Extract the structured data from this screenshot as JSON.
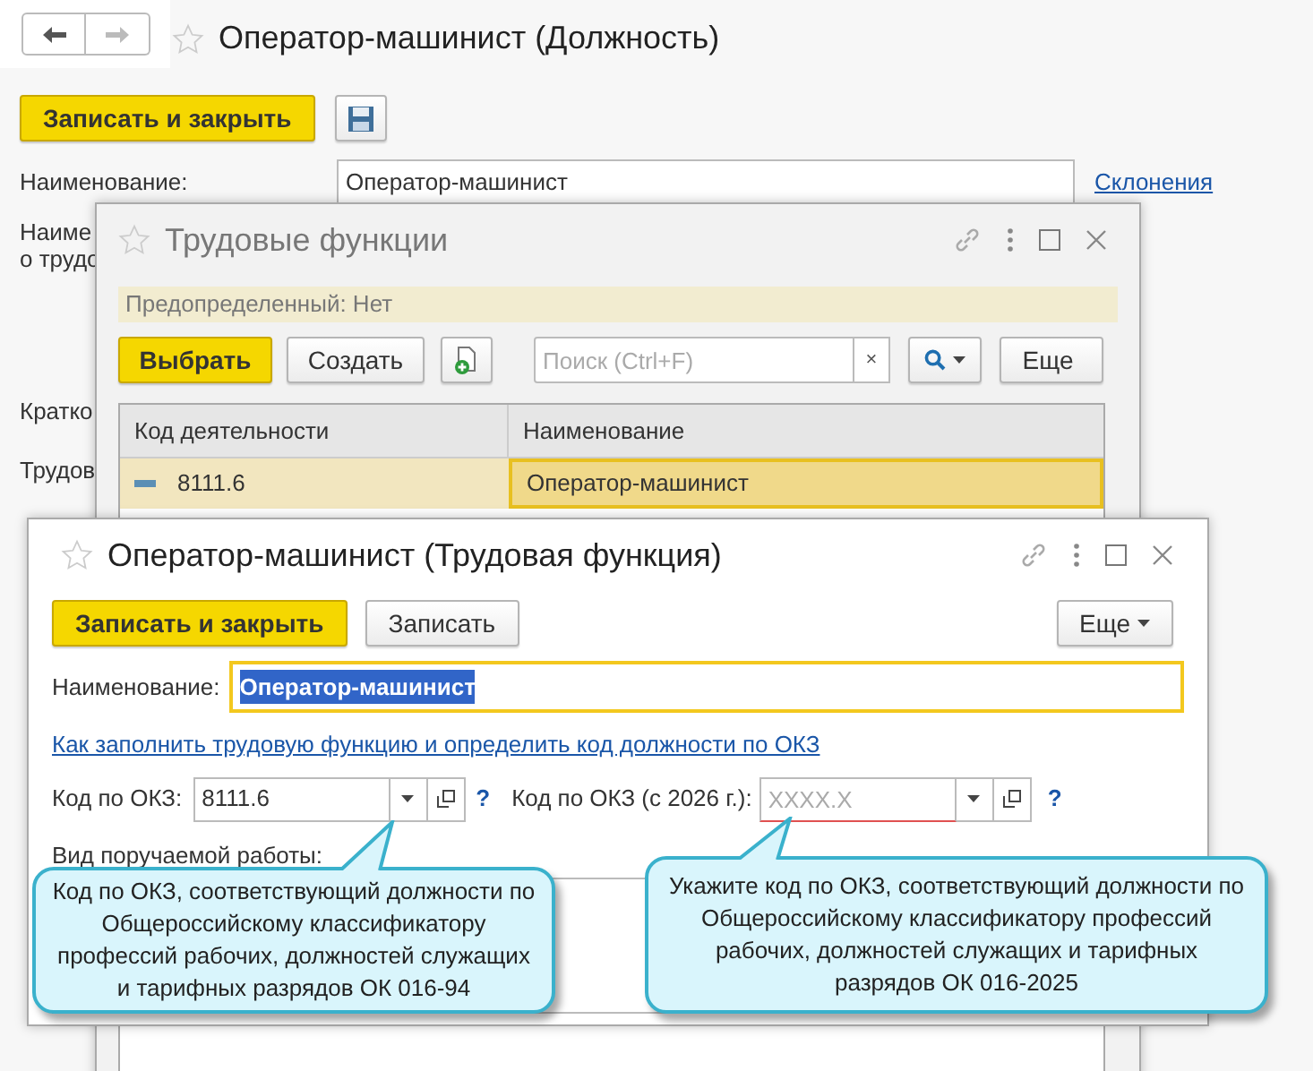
{
  "main_form": {
    "title": "Оператор-машинист (Должность)",
    "favorite": false,
    "save_close_button": "Записать и закрыть",
    "name_label": "Наименование:",
    "name_value": "Оператор-машинист",
    "declension_link": "Склонения",
    "cut_labels": [
      "Наиме",
      "о трудо",
      "Кратко",
      "Трудов"
    ]
  },
  "functions_window": {
    "title": "Трудовые функции",
    "favorite": false,
    "info": "Предопределенный: Нет",
    "choose_button": "Выбрать",
    "create_button": "Создать",
    "search": {
      "placeholder": "Поиск (Ctrl+F)",
      "clear": "×"
    },
    "more_button": "Еще",
    "table": {
      "columns": [
        "Код деятельности",
        "Наименование"
      ],
      "rows": [
        {
          "code": "8111.6",
          "name": "Оператор-машинист",
          "selected": true
        }
      ]
    }
  },
  "function_window": {
    "title": "Оператор-машинист (Трудовая функция)",
    "favorite": false,
    "save_close_button": "Записать и закрыть",
    "save_button": "Записать",
    "more_button": "Еще",
    "name_label": "Наименование:",
    "name_value": "Оператор-машинист",
    "help_link": "Как заполнить трудовую функцию и определить код должности по ОКЗ",
    "okz_label": "Код по ОКЗ:",
    "okz_value": "8111.6",
    "okz_help": "?",
    "okz2026_label": "Код по ОКЗ (с 2026 г.):",
    "okz2026_placeholder": "XXXX.X",
    "okz2026_help": "?",
    "work_kind_label": "Вид поручаемой работы:"
  },
  "callouts": [
    "Код по ОКЗ, соответствующий должности по Общероссийскому классификатору профессий рабочих, должностей служащих и тарифных разрядов ОК 016-94",
    "Укажите код по ОКЗ, соответствующий должности по Общероссийскому классификатору профессий рабочих, должностей служащих и тарифных разрядов ОК 016-2025"
  ]
}
